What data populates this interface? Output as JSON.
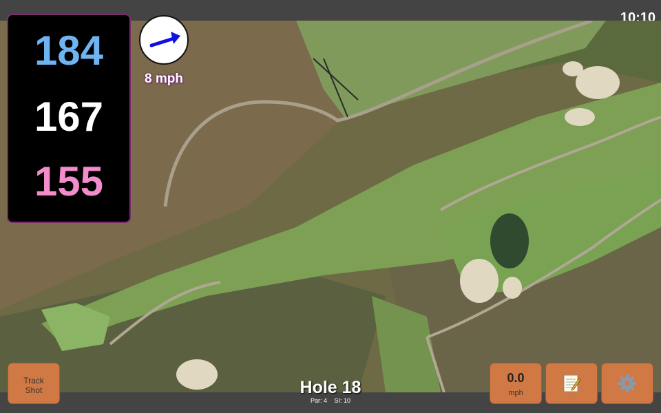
{
  "clock": "10:10",
  "yardages": {
    "back": "184",
    "middle": "167",
    "front": "155"
  },
  "wind": {
    "speed": "8 mph",
    "arrow_color": "#1010e0"
  },
  "hole": {
    "title": "Hole 18",
    "par": "Par: 4",
    "si": "SI: 10"
  },
  "buttons": {
    "track_line1": "Track",
    "track_line2": "Shot",
    "speed_value": "0.0",
    "speed_unit": "mph",
    "notes_icon": "notepad-icon",
    "settings_icon": "gear-icon"
  },
  "colors": {
    "button": "#d07945",
    "back_yardage": "#6fb3f2",
    "front_yardage": "#f28ccb",
    "border_accent": "#7a2d6e"
  }
}
